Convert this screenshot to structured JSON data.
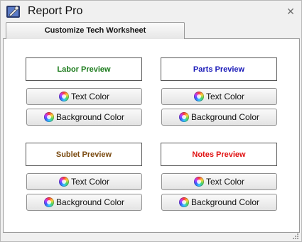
{
  "window": {
    "title": "Report Pro"
  },
  "tab": {
    "label": "Customize Tech Worksheet"
  },
  "sections": [
    {
      "preview_label": "Labor Preview",
      "preview_color": "#1a7a1a"
    },
    {
      "preview_label": "Parts Preview",
      "preview_color": "#1a1ab8"
    },
    {
      "preview_label": "Sublet  Preview",
      "preview_color": "#7a4a10"
    },
    {
      "preview_label": "Notes Preview",
      "preview_color": "#e01010"
    }
  ],
  "buttons": {
    "text_color": "Text Color",
    "background_color": "Background Color"
  },
  "icons": {
    "app": "report-pro-wrench-icon",
    "close": "close-icon",
    "color_wheel": "color-wheel-icon"
  }
}
